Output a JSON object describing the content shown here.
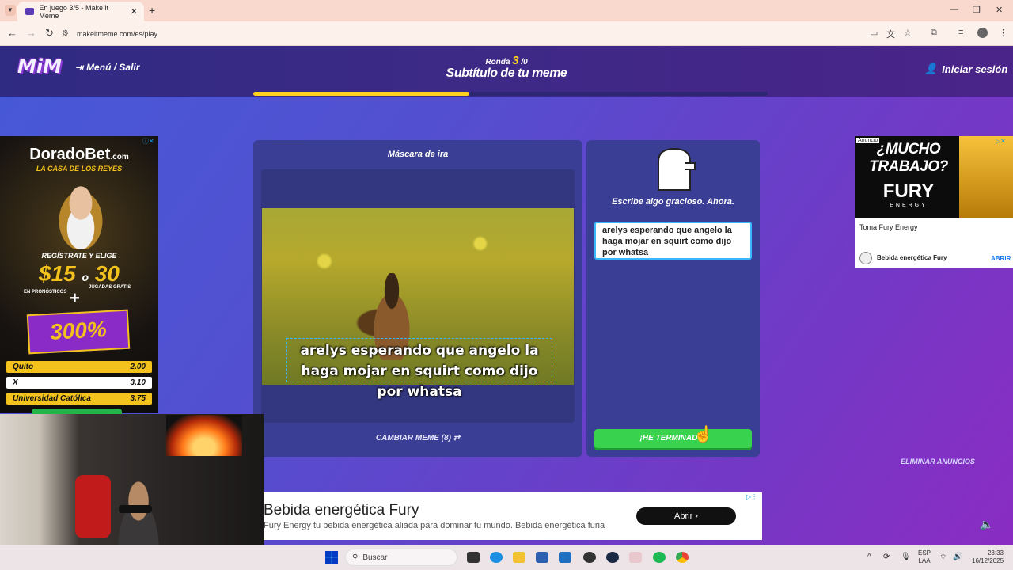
{
  "browser": {
    "tab_title": "En juego 3/5 - Make it Meme",
    "url": "makeitmeme.com/es/play"
  },
  "header": {
    "logo": "MiM",
    "menu_label": "Menú / Salir",
    "round_prefix": "Ronda",
    "round_current": "3",
    "round_suffix": "/0",
    "subtitle": "Subtítulo de tu meme",
    "login_label": "Iniciar sesión",
    "progress_fraction": 0.42
  },
  "meme_panel": {
    "template_name": "Máscara de ira",
    "caption": "arelys esperando que angelo la haga mojar en squirt como dijo por whatsa",
    "change_meme_label": "CAMBIAR MEME (8)"
  },
  "input_panel": {
    "prompt": "Escribe algo gracioso. Ahora.",
    "text_value": "arelys esperando que angelo la haga mojar en squirt como dijo por whatsa",
    "done_label": "¡HE TERMINADO!"
  },
  "remove_ads_label": "ELIMINAR ANUNCIOS",
  "left_ad": {
    "brand": "DoradoBet",
    "brand_suffix": ".com",
    "tagline": "LA CASA DE LOS REYES",
    "register": "REGÍSTRATE Y ELIGE",
    "amount1": "$15",
    "amount_o": "o",
    "amount2": "30",
    "pronosticos": "EN PRONÓSTICOS",
    "jugadas": "JUGADAS GRATIS",
    "plus": "+",
    "percent": "300%",
    "odds": [
      {
        "team": "Quito",
        "value": "2.00"
      },
      {
        "team": "X",
        "value": "3.10"
      },
      {
        "team": "Universidad Católica",
        "value": "3.75"
      }
    ]
  },
  "right_ad": {
    "badge": "Anuncio",
    "headline": "¿MUCHO TRABAJO?",
    "brand": "FURY",
    "energy": "ENERGY",
    "text": "Toma Fury Energy",
    "source": "Bebida energética Fury",
    "cta": "ABRIR"
  },
  "bottom_ad": {
    "title": "Bebida energética Fury",
    "description": "Fury Energy tu bebida energética aliada para dominar tu mundo. Bebida energética furia",
    "cta": "Abrir"
  },
  "taskbar": {
    "search_placeholder": "Buscar",
    "lang_line1": "ESP",
    "lang_line2": "LAA",
    "time": "23:33",
    "date": "16/12/2025"
  },
  "colors": {
    "accent_yellow": "#ffd21e",
    "done_green": "#38d24e",
    "panel": "#3a3e94"
  }
}
